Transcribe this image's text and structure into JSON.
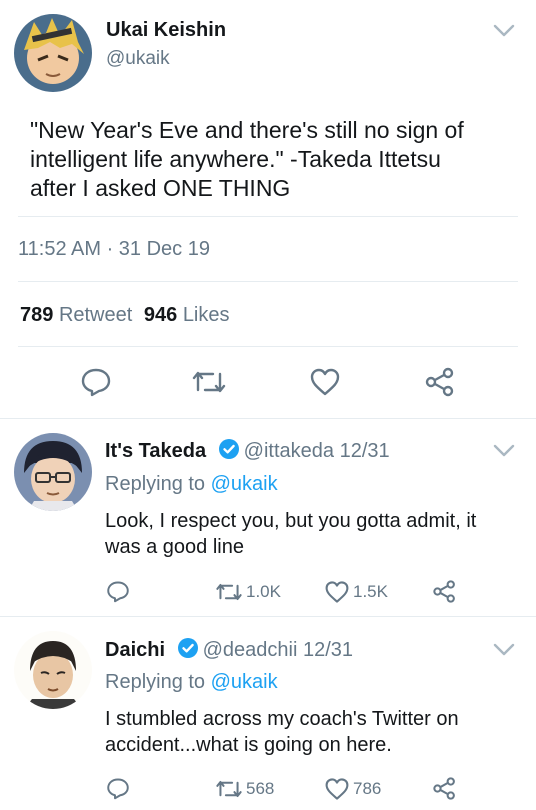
{
  "main_tweet": {
    "display_name": "Ukai Keishin",
    "handle": "@ukaik",
    "text_lines": [
      "\"New Year's Eve and there's still no sign of",
      "intelligent life anywhere.\" -Takeda Ittetsu",
      "after I asked ONE THING"
    ],
    "timestamp": "11:52 AM · 31 Dec 19",
    "retweet_count": "789",
    "retweet_label": "Retweet",
    "likes_count": "946",
    "likes_label": "Likes"
  },
  "replies": [
    {
      "display_name": "It's Takeda",
      "handle": "@ittakeda",
      "date": "12/31",
      "replying_prefix": "Replying to",
      "replying_to": "@ukaik",
      "text_lines": [
        "Look, I respect you, but you gotta admit, it",
        "was a good line"
      ],
      "retweet_count": "1.0K",
      "like_count": "1.5K"
    },
    {
      "display_name": "Daichi",
      "handle": "@deadchii",
      "date": "12/31",
      "replying_prefix": "Replying to",
      "replying_to": "@ukaik",
      "text_lines": [
        "I stumbled across my coach's Twitter on",
        "accident...what is going on here."
      ],
      "retweet_count": "568",
      "like_count": "786"
    }
  ],
  "colors": {
    "accent": "#1da1f2",
    "secondary_text": "#657786",
    "divider": "#e6ecf0"
  },
  "icons": [
    "chevron-down-icon",
    "reply-icon",
    "retweet-icon",
    "like-icon",
    "share-icon",
    "verified-badge-icon"
  ]
}
